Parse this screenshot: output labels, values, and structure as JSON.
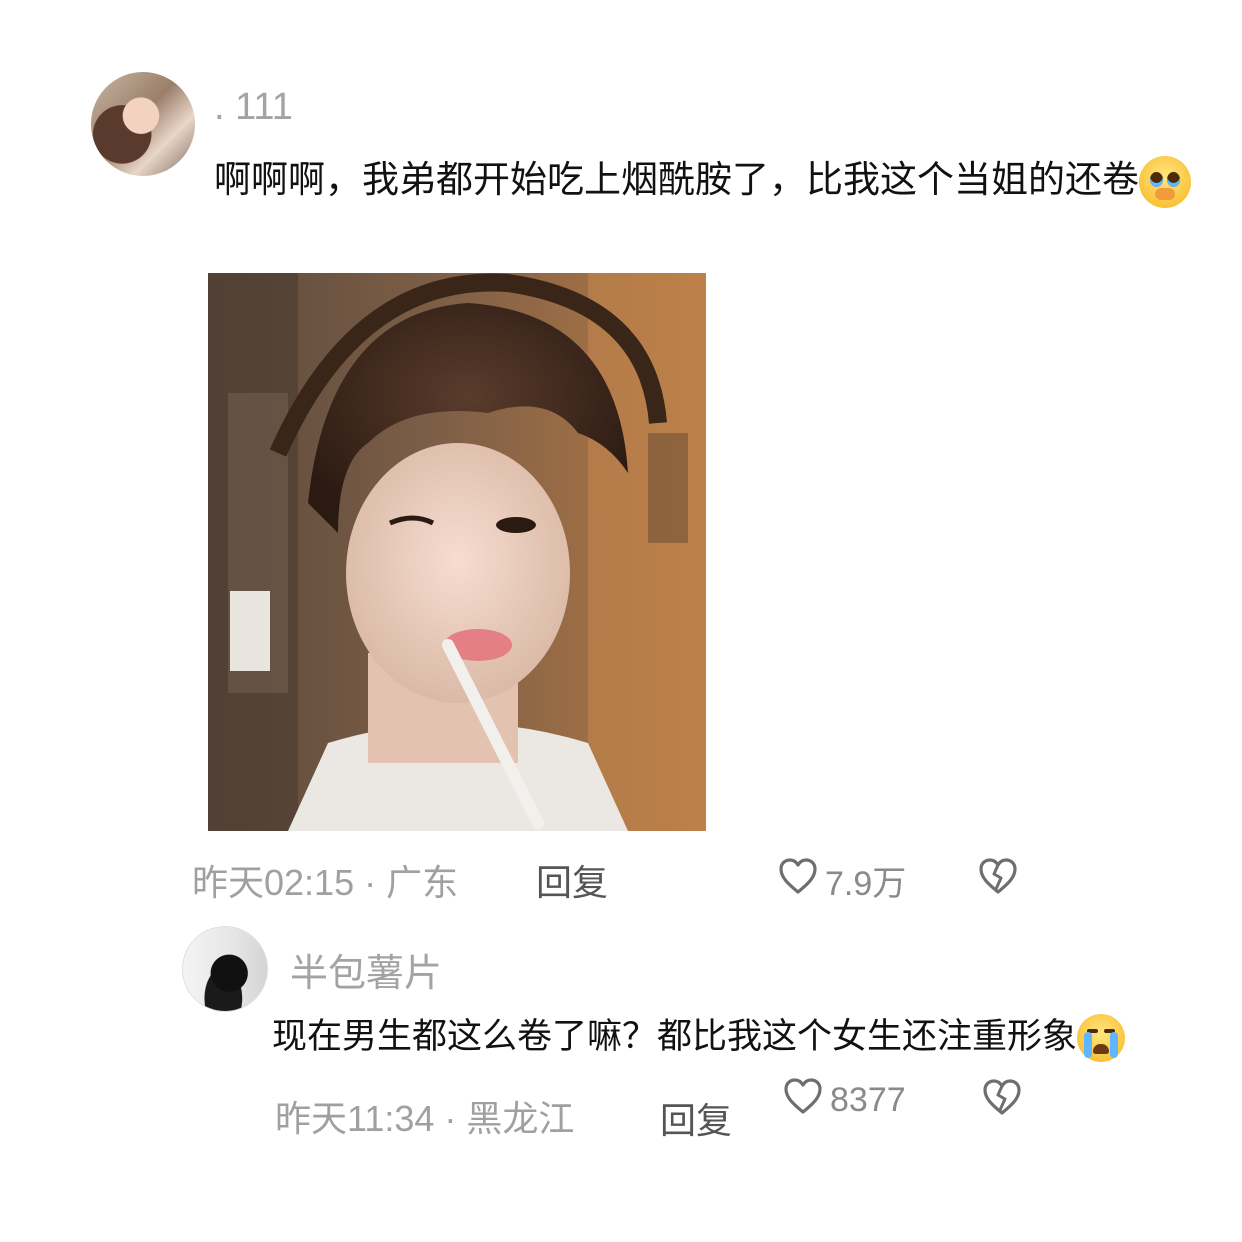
{
  "comment": {
    "username": ". 111",
    "text": "啊啊啊，我弟都开始吃上烟酰胺了，比我这个当姐的还卷",
    "emoji": "pleading-face-emoji",
    "time": "昨天02:15",
    "separator": " · ",
    "location": "广东",
    "reply_label": "回复",
    "like_count": "7.9万"
  },
  "reply": {
    "username": "半包薯片",
    "text": "现在男生都这么卷了嘛？都比我这个女生还注重形象",
    "emoji": "loudly-crying-face-emoji",
    "time": "昨天11:34",
    "separator": " · ",
    "location": "黑龙江",
    "reply_label": "回复",
    "like_count": "8377"
  },
  "icons": {
    "like": "heart-outline-icon",
    "dislike": "broken-heart-icon"
  },
  "colors": {
    "meta": "#a0a0a0",
    "username": "#a3a3a3",
    "text": "#111111"
  }
}
